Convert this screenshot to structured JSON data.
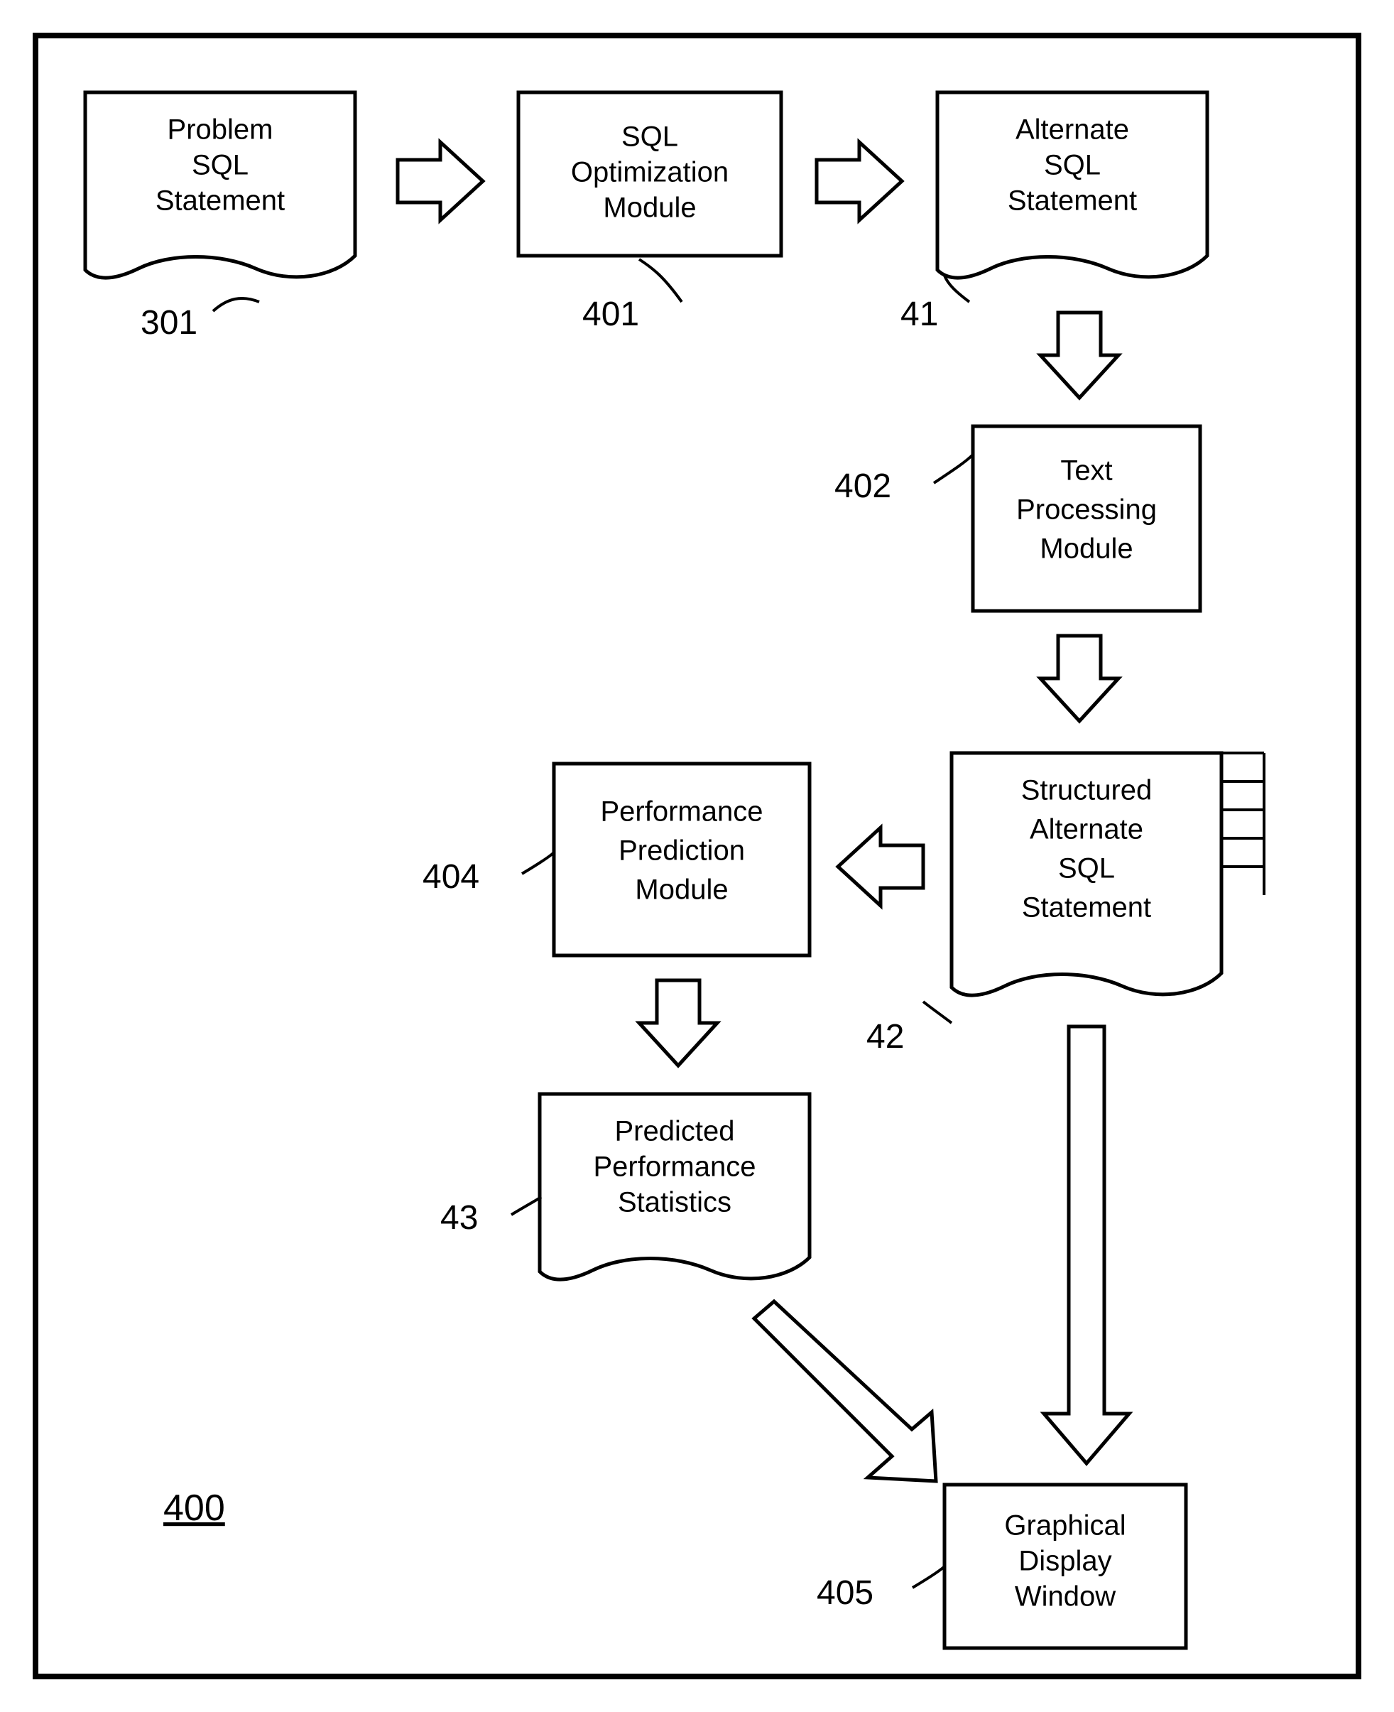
{
  "nodes": {
    "problem": {
      "lines": [
        "Problem",
        "SQL",
        "Statement"
      ],
      "ref": "301"
    },
    "optimize": {
      "lines": [
        "SQL",
        "Optimization",
        "Module"
      ],
      "ref": "401"
    },
    "alternate": {
      "lines": [
        "Alternate",
        "SQL",
        "Statement"
      ],
      "ref": "41"
    },
    "textproc": {
      "lines": [
        "Text",
        "Processing",
        "Module"
      ],
      "ref": "402"
    },
    "structured": {
      "lines": [
        "Structured",
        "Alternate",
        "SQL",
        "Statement"
      ],
      "ref": "42"
    },
    "perfpred": {
      "lines": [
        "Performance",
        "Prediction",
        "Module"
      ],
      "ref": "404"
    },
    "predstats": {
      "lines": [
        "Predicted",
        "Performance",
        "Statistics"
      ],
      "ref": "43"
    },
    "display": {
      "lines": [
        "Graphical",
        "Display",
        "Window"
      ],
      "ref": "405"
    }
  },
  "figure_label": "400"
}
